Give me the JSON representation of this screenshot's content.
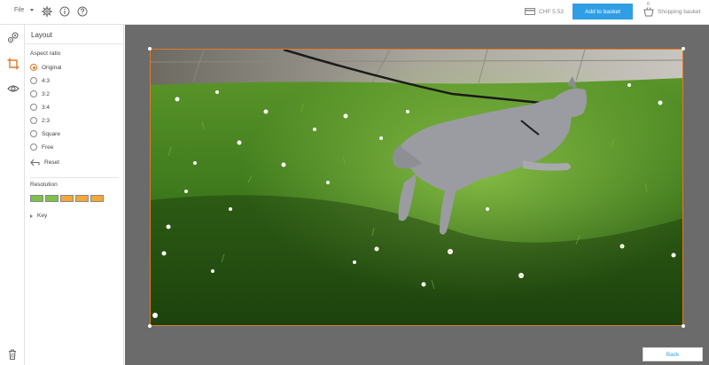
{
  "header": {
    "file_menu": "File",
    "price": "CHF 5.53",
    "add_to_basket": "Add to basket",
    "shopping_basket": "Shopping basket",
    "basket_count": "0"
  },
  "panel": {
    "title": "Layout",
    "aspect_ratio_label": "Aspect ratio",
    "aspect_options": [
      "Original",
      "4:3",
      "3:2",
      "3:4",
      "2:3",
      "Square",
      "Free"
    ],
    "selected_index": 0,
    "reset_label": "Reset",
    "resolution_label": "Resolution",
    "resolution_colors": [
      "#7cc24a",
      "#7cc24a",
      "#f4a73a",
      "#f4a73a",
      "#f4a73a"
    ],
    "key_label": "Key"
  },
  "footer": {
    "back_label": "Back"
  },
  "colors": {
    "accent": "#e07a28",
    "primary_button": "#2f9ee5",
    "canvas_bg": "#6b6b6b"
  },
  "icons": {
    "settings": "gear-icon",
    "info": "info-icon",
    "help": "help-icon",
    "price": "card-icon",
    "basket": "basket-icon",
    "rail_effects": "effects-icon",
    "rail_crop": "crop-icon",
    "rail_view": "eye-icon",
    "trash": "trash-icon"
  }
}
